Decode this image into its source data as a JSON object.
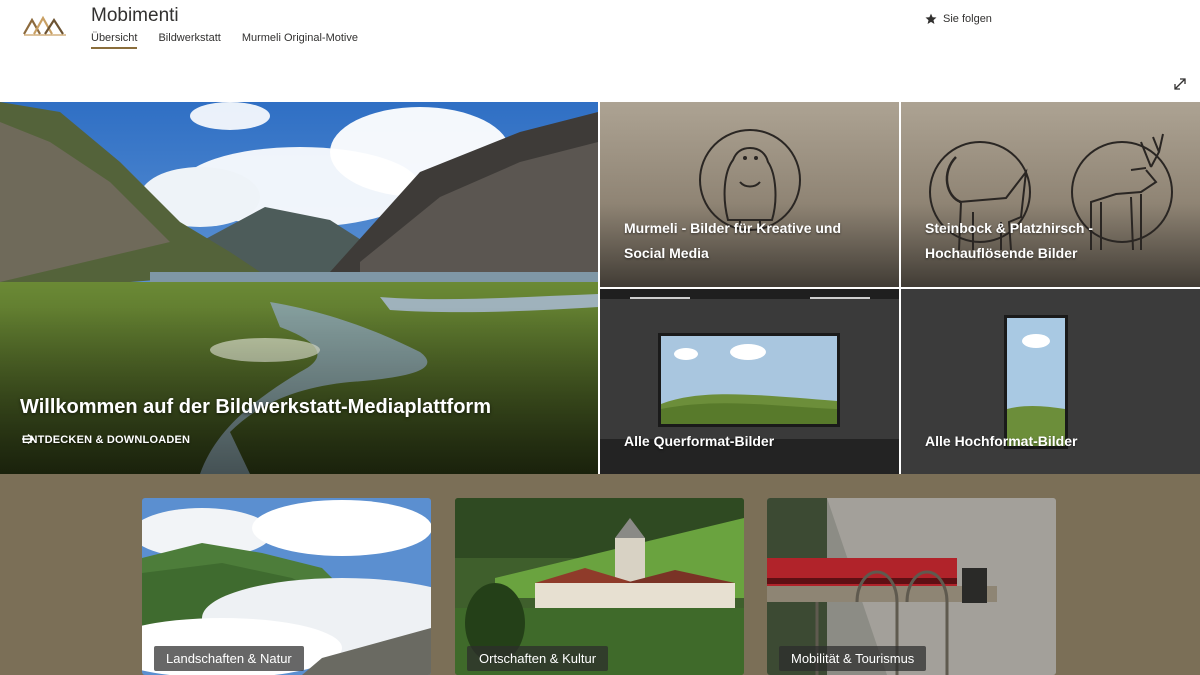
{
  "header": {
    "site_title": "Mobimenti",
    "nav": [
      {
        "label": "Übersicht",
        "active": true
      },
      {
        "label": "Bildwerkstatt",
        "active": false
      },
      {
        "label": "Murmeli Original-Motive",
        "active": false
      }
    ],
    "follow_label": "Sie folgen",
    "logo_icon": "mountain-logo-icon",
    "accent_color": "#8a6d3b"
  },
  "hero": {
    "main": {
      "title": "Willkommen auf der Bildwerkstatt-Mediaplattform",
      "link_label": "ENTDECKEN & DOWNLOADEN"
    },
    "tiles": [
      {
        "label_line1": "Murmeli - Bilder für Kreative und",
        "label_line2": "Social Media",
        "icon": "marmot-icon"
      },
      {
        "label_line1": "Steinbock & Platzhirsch -",
        "label_line2": "Hochauflösende Bilder",
        "icon": "ibex-and-stag-icon"
      },
      {
        "label_line1": "Alle Querformat-Bilder",
        "icon": "landscape-frame-icon"
      },
      {
        "label_line1": "Alle Hochformat-Bilder",
        "icon": "portrait-frame-icon"
      }
    ]
  },
  "categories": [
    {
      "label": "Landschaften & Natur"
    },
    {
      "label": "Ortschaften & Kultur"
    },
    {
      "label": "Mobilität & Tourismus"
    }
  ],
  "colors": {
    "band_background": "#7b6f57",
    "tile_background": "#8f8474"
  }
}
